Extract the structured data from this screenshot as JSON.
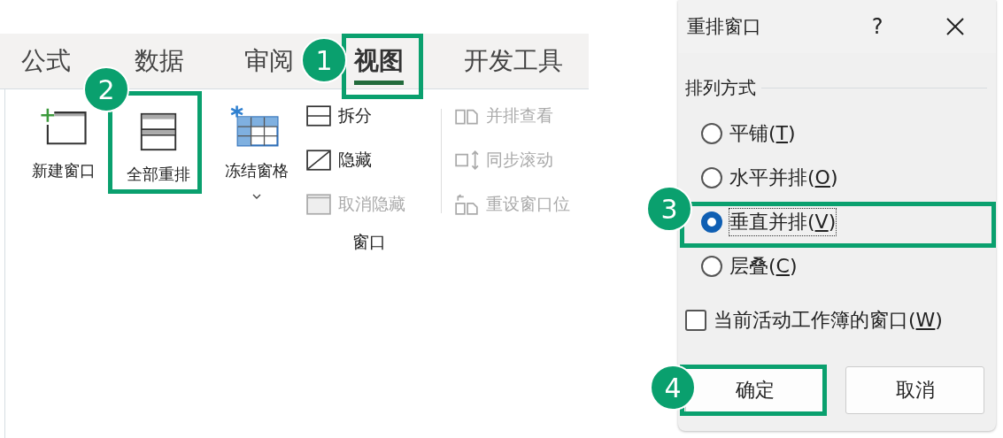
{
  "ribbon": {
    "tabs": [
      {
        "label": "公式",
        "selected": false
      },
      {
        "label": "数据",
        "selected": false
      },
      {
        "label": "审阅",
        "selected": false
      },
      {
        "label": "视图",
        "selected": true,
        "step": "1"
      },
      {
        "label": "开发工具",
        "selected": false
      }
    ],
    "large_buttons": [
      {
        "kind": "new-window",
        "label": "新建窗口"
      },
      {
        "kind": "arrange",
        "label": "全部重排",
        "step": "2"
      },
      {
        "kind": "freeze",
        "label": "冻结窗格",
        "dropdown": true
      }
    ],
    "column_1": [
      {
        "kind": "split",
        "label": "拆分",
        "disabled": false
      },
      {
        "kind": "hide",
        "label": "隐藏",
        "disabled": false
      },
      {
        "kind": "unhide",
        "label": "取消隐藏",
        "disabled": true
      }
    ],
    "column_2": [
      {
        "kind": "side-by-side",
        "label": "并排查看",
        "disabled": true
      },
      {
        "kind": "sync-scroll",
        "label": "同步滚动",
        "disabled": true
      },
      {
        "kind": "reset-position",
        "label": "重设窗口位",
        "disabled": true
      }
    ],
    "group_label": "窗口"
  },
  "dialog": {
    "title": "重排窗口",
    "help": "?",
    "section": "排列方式",
    "options": [
      {
        "before": "平铺(",
        "key": "T",
        "after": ")",
        "selected": false
      },
      {
        "before": "水平并排(",
        "key": "O",
        "after": ")",
        "selected": false
      },
      {
        "before": "垂直并排(",
        "key": "V",
        "after": ")",
        "selected": true,
        "step": "3"
      },
      {
        "before": "层叠(",
        "key": "C",
        "after": ")",
        "selected": false
      }
    ],
    "checkbox": {
      "before": "当前活动工作簿的窗口(",
      "key": "W",
      "after": ")",
      "checked": false
    },
    "buttons": [
      {
        "label": "确定",
        "step": "4"
      },
      {
        "label": "取消"
      }
    ]
  }
}
